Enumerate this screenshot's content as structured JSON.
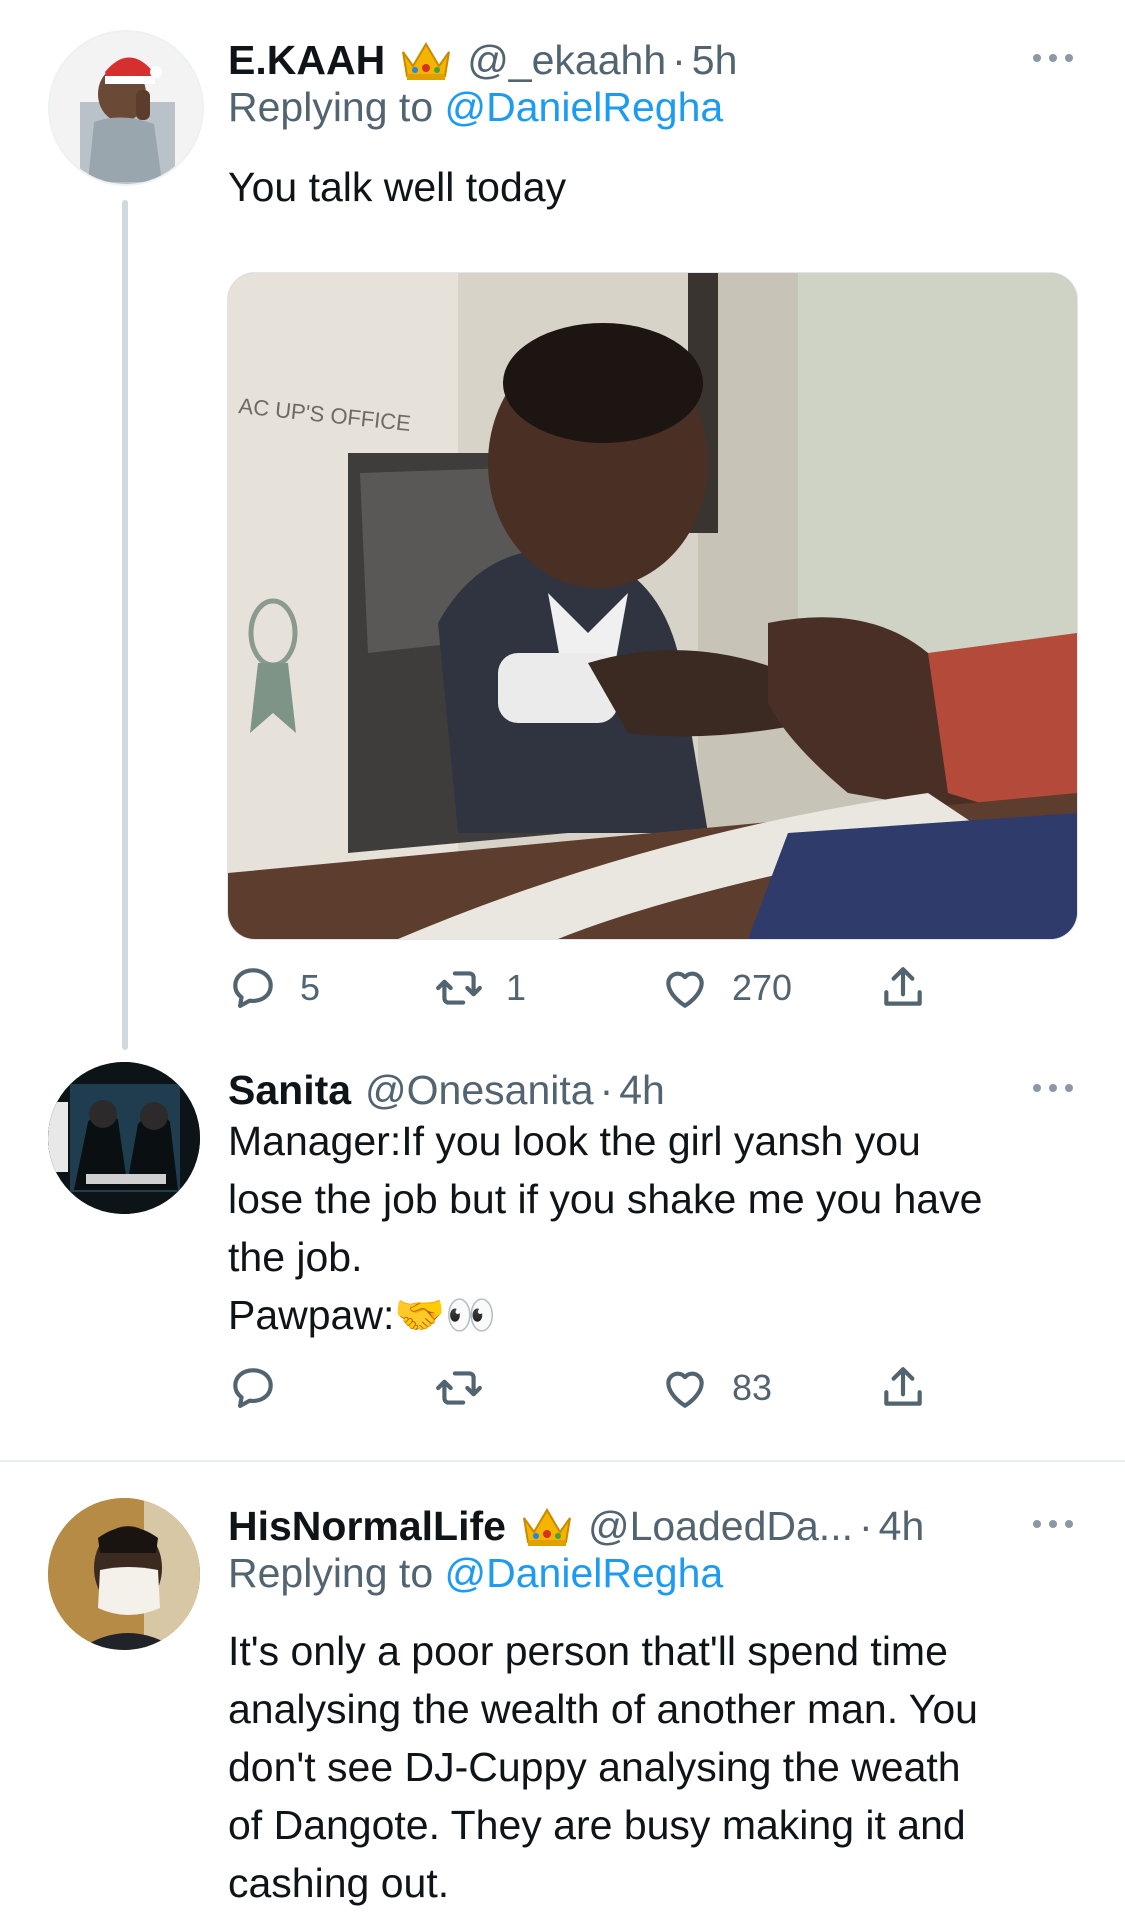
{
  "tweets": [
    {
      "name": "E.KAAH",
      "handle": "@_ekaahh",
      "separator": "·",
      "time": "5h",
      "replying_prefix": "Replying to ",
      "replying_to": "@DanielRegha",
      "text": "You talk well today",
      "has_crown": true,
      "stats": {
        "replies": "5",
        "retweets": "1",
        "likes": "270"
      }
    },
    {
      "name": "Sanita",
      "handle": "@Onesanita",
      "separator": "·",
      "time": "4h",
      "lines": [
        "Manager:If you look the girl yansh you",
        "lose the job but if you shake me you have",
        "the job.",
        "Pawpaw:🤝👀"
      ],
      "stats": {
        "replies": "",
        "retweets": "",
        "likes": "83"
      }
    },
    {
      "name": "HisNormalLife",
      "handle": "@LoadedDa...",
      "separator": "·",
      "time": "4h",
      "replying_prefix": "Replying to ",
      "replying_to": "@DanielRegha",
      "has_crown": true,
      "lines": [
        "It's only a poor person that'll spend time",
        "analysing the wealth of another man. You",
        "don't see DJ-Cuppy  analysing the weath",
        "of Dangote. They are busy making it and",
        "cashing out."
      ]
    }
  ],
  "media": {
    "image_text_sign": "AC UP'S OFFICE"
  },
  "colors": {
    "accent": "#1d9bf0",
    "secondary_text": "#536471",
    "primary_text": "#0f1419",
    "thread_line": "#cfd9de"
  },
  "icons": [
    "reply-icon",
    "retweet-icon",
    "like-icon",
    "share-icon",
    "more-icon",
    "crown-icon"
  ]
}
